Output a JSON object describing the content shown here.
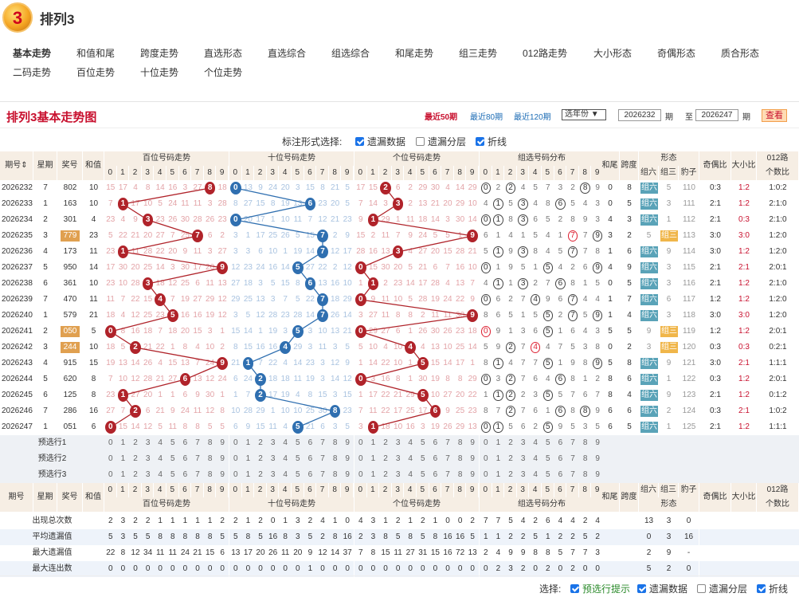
{
  "header": {
    "logo_text": "3",
    "title": "排列3"
  },
  "nav": [
    "基本走势",
    "和值和尾",
    "跨度走势",
    "直选形态",
    "直选综合",
    "组选综合",
    "和尾走势",
    "组三走势",
    "012路走势",
    "大小形态",
    "奇偶形态",
    "质合形态",
    "二码走势",
    "百位走势",
    "十位走势",
    "个位走势"
  ],
  "panel": {
    "title": "排列3基本走势图",
    "recent": [
      "最近50期",
      "最近80期",
      "最近120期"
    ],
    "year_select": "选年份 ▼",
    "from": "2026232",
    "to": "2026247",
    "qi1": "期",
    "zhi": "至",
    "qi2": "期",
    "query": "查看"
  },
  "mark": {
    "label": "标注形式选择:",
    "opts": [
      "遗漏数据",
      "遗漏分层",
      "折线"
    ],
    "checked": [
      true,
      false,
      true
    ]
  },
  "columns": {
    "qihao": "期号",
    "week": "星期",
    "award": "奖号",
    "sum": "和值",
    "bai": "百位号码走势",
    "shi": "十位号码走势",
    "ge": "个位号码走势",
    "zu": "组选号码分布",
    "hewei": "和尾",
    "kuadu": "跨度",
    "xingtai": "形态",
    "zu6": "组六",
    "zu3": "组三",
    "baozi": "豹子",
    "jiou": "奇偶比",
    "daxiao": "大小比",
    "lu": "012路",
    "lu2": "个数比"
  },
  "rows": [
    {
      "q": "2026232",
      "w": "7",
      "n": "802",
      "s": "10",
      "hl": false,
      "hw": "0",
      "kd": "8",
      "form": "组六",
      "jo": "0:3",
      "dx": "1:2",
      "lu": "1:0:2"
    },
    {
      "q": "2026233",
      "w": "1",
      "n": "163",
      "s": "10",
      "hl": false,
      "hw": "0",
      "kd": "5",
      "form": "组六",
      "jo": "2:1",
      "dx": "1:2",
      "lu": "2:1:0"
    },
    {
      "q": "2026234",
      "w": "2",
      "n": "301",
      "s": "4",
      "hl": false,
      "hw": "4",
      "kd": "3",
      "form": "组六",
      "jo": "2:1",
      "dx": "0:3",
      "lu": "2:1:0"
    },
    {
      "q": "2026235",
      "w": "3",
      "n": "779",
      "s": "23",
      "hl": true,
      "hw": "3",
      "kd": "2",
      "form": "组三",
      "jo": "3:0",
      "dx": "3:0",
      "lu": "1:2:0"
    },
    {
      "q": "2026236",
      "w": "4",
      "n": "173",
      "s": "11",
      "hl": false,
      "hw": "1",
      "kd": "6",
      "form": "组六",
      "jo": "3:0",
      "dx": "1:2",
      "lu": "1:2:0"
    },
    {
      "q": "2026237",
      "w": "5",
      "n": "950",
      "s": "14",
      "hl": false,
      "hw": "4",
      "kd": "9",
      "form": "组六",
      "jo": "2:1",
      "dx": "2:1",
      "lu": "2:0:1"
    },
    {
      "q": "2026238",
      "w": "6",
      "n": "361",
      "s": "10",
      "hl": false,
      "hw": "0",
      "kd": "5",
      "form": "组六",
      "jo": "2:1",
      "dx": "1:2",
      "lu": "2:1:0"
    },
    {
      "q": "2026239",
      "w": "7",
      "n": "470",
      "s": "11",
      "hl": false,
      "hw": "1",
      "kd": "7",
      "form": "组六",
      "jo": "1:2",
      "dx": "1:2",
      "lu": "1:2:0"
    },
    {
      "q": "2026240",
      "w": "1",
      "n": "579",
      "s": "21",
      "hl": false,
      "hw": "1",
      "kd": "4",
      "form": "组六",
      "jo": "3:0",
      "dx": "3:0",
      "lu": "1:2:0"
    },
    {
      "q": "2026241",
      "w": "2",
      "n": "050",
      "s": "5",
      "hl": true,
      "hw": "5",
      "kd": "5",
      "form": "组三",
      "jo": "1:2",
      "dx": "1:2",
      "lu": "2:0:1"
    },
    {
      "q": "2026242",
      "w": "3",
      "n": "244",
      "s": "10",
      "hl": true,
      "hw": "0",
      "kd": "2",
      "form": "组三",
      "jo": "0:3",
      "dx": "0:3",
      "lu": "0:2:1"
    },
    {
      "q": "2026243",
      "w": "4",
      "n": "915",
      "s": "15",
      "hl": false,
      "hw": "5",
      "kd": "8",
      "form": "组六",
      "jo": "3:0",
      "dx": "2:1",
      "lu": "1:1:1"
    },
    {
      "q": "2026244",
      "w": "5",
      "n": "620",
      "s": "8",
      "hl": false,
      "hw": "8",
      "kd": "6",
      "form": "组六",
      "jo": "0:3",
      "dx": "1:2",
      "lu": "2:0:1"
    },
    {
      "q": "2026245",
      "w": "6",
      "n": "125",
      "s": "8",
      "hl": false,
      "hw": "8",
      "kd": "4",
      "form": "组六",
      "jo": "2:1",
      "dx": "1:2",
      "lu": "0:1:2"
    },
    {
      "q": "2026246",
      "w": "7",
      "n": "286",
      "s": "16",
      "hl": false,
      "hw": "6",
      "kd": "6",
      "form": "组六",
      "jo": "0:3",
      "dx": "2:1",
      "lu": "1:0:2"
    },
    {
      "q": "2026247",
      "w": "1",
      "n": "051",
      "s": "6",
      "hl": false,
      "hw": "6",
      "kd": "5",
      "form": "组六",
      "jo": "2:1",
      "dx": "1:2",
      "lu": "1:1:1"
    }
  ],
  "presel": [
    "预选行1",
    "预选行2",
    "预选行3"
  ],
  "stats": {
    "labels": [
      "出现总次数",
      "平均遗漏值",
      "最大遗漏值",
      "最大连出数"
    ],
    "bai": [
      [
        2,
        3,
        2,
        2,
        1,
        1,
        1,
        1,
        1,
        2
      ],
      [
        5,
        3,
        5,
        5,
        8,
        8,
        8,
        8,
        8,
        5
      ],
      [
        22,
        8,
        12,
        34,
        11,
        11,
        24,
        21,
        15,
        6
      ],
      [
        0,
        0,
        0,
        0,
        0,
        0,
        0,
        0,
        0,
        0
      ]
    ],
    "shi": [
      [
        2,
        1,
        2,
        0,
        1,
        3,
        2,
        4,
        1,
        0
      ],
      [
        5,
        8,
        5,
        16,
        8,
        3,
        5,
        2,
        8,
        16
      ],
      [
        13,
        17,
        20,
        26,
        11,
        20,
        9,
        12,
        14,
        37
      ],
      [
        0,
        0,
        0,
        0,
        0,
        0,
        1,
        0,
        0,
        0
      ]
    ],
    "ge": [
      [
        4,
        3,
        1,
        2,
        1,
        2,
        1,
        0,
        0,
        2
      ],
      [
        2,
        3,
        8,
        5,
        8,
        5,
        8,
        16,
        16,
        5
      ],
      [
        7,
        8,
        15,
        11,
        27,
        31,
        15,
        16,
        72,
        13
      ],
      [
        0,
        0,
        0,
        0,
        0,
        0,
        0,
        0,
        0,
        0
      ]
    ],
    "zu": [
      [
        7,
        7,
        5,
        4,
        2,
        6,
        4,
        4,
        2,
        4
      ],
      [
        1,
        1,
        2,
        2,
        5,
        1,
        2,
        2,
        5,
        2
      ],
      [
        2,
        4,
        9,
        9,
        8,
        8,
        5,
        7,
        7,
        3
      ],
      [
        0,
        2,
        3,
        2,
        0,
        2,
        0,
        2,
        0,
        0
      ]
    ],
    "xt": [
      [
        "13",
        "3",
        "0"
      ],
      [
        "0",
        "3",
        "16"
      ],
      [
        "2",
        "9",
        "-"
      ],
      [
        "5",
        "2",
        "0"
      ]
    ]
  },
  "bottom": {
    "label": "选择:",
    "opts": [
      "预选行提示",
      "遗漏数据",
      "遗漏分层",
      "折线"
    ],
    "checked": [
      true,
      true,
      false,
      true
    ]
  },
  "colors": {
    "red": "#b0232a",
    "blue": "#2f6fb0",
    "head": "#f6eee4",
    "hl": "#e0a050",
    "accent": "#c8102e"
  }
}
